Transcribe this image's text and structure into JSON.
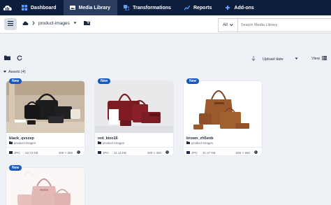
{
  "nav": {
    "items": [
      {
        "label": "Dashboard",
        "icon": "dashboard-icon",
        "active": false
      },
      {
        "label": "Media Library",
        "icon": "media-library-icon",
        "active": true
      },
      {
        "label": "Transformations",
        "icon": "transformations-icon",
        "active": false
      },
      {
        "label": "Reports",
        "icon": "reports-icon",
        "active": false
      },
      {
        "label": "Add-ons",
        "icon": "add-ons-icon",
        "active": false
      }
    ]
  },
  "toolbar": {
    "folder_name": "product-images"
  },
  "search": {
    "type_label": "All",
    "placeholder": "Search Media Library"
  },
  "sort": {
    "label": "Upload date"
  },
  "view": {
    "label": "View"
  },
  "assets": {
    "label": "Assets (4)"
  },
  "cards": [
    {
      "badge": "New",
      "name": "black_qvszep",
      "folder": "product-images",
      "format": "JPG",
      "size": "22.72 KB",
      "dimensions": "300 × 300"
    },
    {
      "badge": "New",
      "name": "red_ktzo16",
      "folder": "product-images",
      "format": "JPG",
      "size": "11.11 KB",
      "dimensions": "300 × 300"
    },
    {
      "badge": "New",
      "name": "brown_zh5enb",
      "folder": "product-images",
      "format": "JPG",
      "size": "41.27 KB",
      "dimensions": "550 × 550"
    },
    {
      "badge": "New",
      "name": "",
      "folder": "",
      "format": "",
      "size": "",
      "dimensions": ""
    }
  ],
  "colors": {
    "nav_bg": "#0c1d3d",
    "nav_active": "#2b3d5e",
    "badge": "#1757c2",
    "page_bg": "#eef1f6"
  }
}
